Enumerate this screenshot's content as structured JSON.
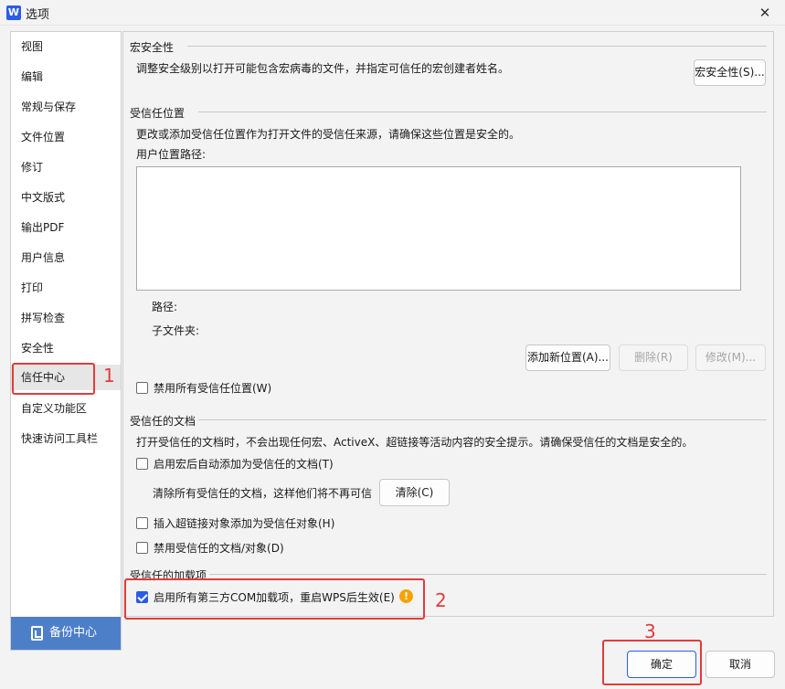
{
  "window": {
    "title": "选项",
    "app_icon_letter": "W"
  },
  "sidebar": {
    "items": [
      {
        "label": "视图"
      },
      {
        "label": "编辑"
      },
      {
        "label": "常规与保存"
      },
      {
        "label": "文件位置"
      },
      {
        "label": "修订"
      },
      {
        "label": "中文版式"
      },
      {
        "label": "输出PDF"
      },
      {
        "label": "用户信息"
      },
      {
        "label": "打印"
      },
      {
        "label": "拼写检查"
      },
      {
        "label": "安全性"
      },
      {
        "label": "信任中心",
        "active": true
      },
      {
        "label": "自定义功能区"
      },
      {
        "label": "快速访问工具栏"
      }
    ],
    "backup_label": "备份中心"
  },
  "macro": {
    "title": "宏安全性",
    "description": "调整安全级别以打开可能包含宏病毒的文件，并指定可信任的宏创建者姓名。",
    "button": "宏安全性(S)..."
  },
  "trusted_locations": {
    "title": "受信任位置",
    "description": "更改或添加受信任位置作为打开文件的受信任来源，请确保这些位置是安全的。",
    "list_label": "用户位置路径:",
    "path_label": "路径:",
    "subfolder_label": "子文件夹:",
    "add_button": "添加新位置(A)...",
    "delete_button": "删除(R)",
    "modify_button": "修改(M)...",
    "disable_all_label": "禁用所有受信任位置(W)",
    "disable_all_checked": false
  },
  "trusted_docs": {
    "title": "受信任的文档",
    "description": "打开受信任的文档时，不会出现任何宏、ActiveX、超链接等活动内容的安全提示。请确保受信任的文档是安全的。",
    "auto_add_label": "启用宏后自动添加为受信任的文档(T)",
    "auto_add_checked": false,
    "clear_text": "清除所有受信任的文档，这样他们将不再可信",
    "clear_button": "清除(C)",
    "hyperlink_label": "插入超链接对象添加为受信任对象(H)",
    "hyperlink_checked": false,
    "disable_docs_label": "禁用受信任的文档/对象(D)",
    "disable_docs_checked": false
  },
  "addins": {
    "title": "受信任的加载项",
    "enable_com_label": "启用所有第三方COM加载项，重启WPS后生效(E)",
    "enable_com_checked": true,
    "warn_icon": "warning-icon"
  },
  "footer": {
    "ok": "确定",
    "cancel": "取消"
  },
  "annotations": {
    "n1": "1",
    "n2": "2",
    "n3": "3"
  },
  "colors": {
    "accent": "#2b5ce6",
    "annotation": "#e23b3b",
    "backup": "#4d7fc9",
    "warning": "#f5a300"
  }
}
